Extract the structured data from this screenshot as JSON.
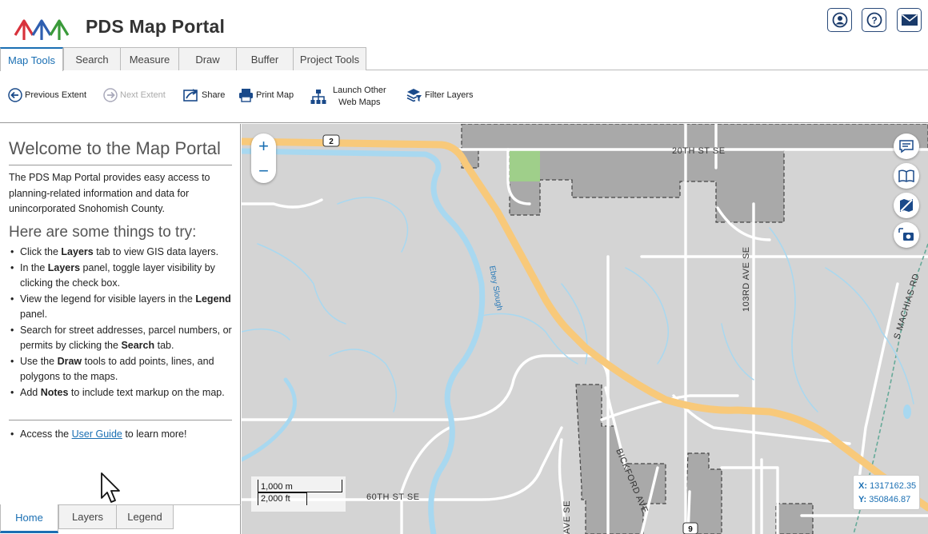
{
  "app": {
    "title": "PDS Map Portal"
  },
  "header_buttons": [
    {
      "icon": "user-icon"
    },
    {
      "icon": "help-icon"
    },
    {
      "icon": "mail-icon"
    }
  ],
  "tabs": [
    "Map Tools",
    "Search",
    "Measure",
    "Draw",
    "Buffer",
    "Project Tools"
  ],
  "active_tab": "Map Tools",
  "toolbar": {
    "previous_extent": "Previous Extent",
    "next_extent": "Next Extent",
    "share": "Share",
    "print_map": "Print Map",
    "launch_line1": "Launch Other",
    "launch_line2": "Web Maps",
    "filter_layers": "Filter Layers"
  },
  "panel": {
    "title": "Welcome to the Map Portal",
    "intro": "The PDS Map Portal provides easy access to planning-related information and data for unincorporated Snohomish County.",
    "subtitle": "Here are some things to try:",
    "tips": [
      {
        "pre": "Click the ",
        "bold": "Layers",
        "post": " tab to view GIS data layers."
      },
      {
        "pre": "In the ",
        "bold": "Layers",
        "post": " panel, toggle layer visibility by clicking the check box."
      },
      {
        "pre": "View the legend for visible layers in the ",
        "bold": "Legend",
        "post": " panel."
      },
      {
        "pre": "Search for street addresses, parcel numbers, or permits by clicking the ",
        "bold": "Search",
        "post": " tab."
      },
      {
        "pre": "Use the ",
        "bold": "Draw",
        "post": " tools to add points, lines, and polygons to the maps."
      },
      {
        "pre": "Add ",
        "bold": "Notes",
        "post": " to include text markup on the map."
      }
    ],
    "guide_pre": "Access the ",
    "guide_link": "User Guide",
    "guide_post": " to learn more!"
  },
  "bottom_tabs": [
    "Home",
    "Layers",
    "Legend"
  ],
  "active_bottom_tab": "Home",
  "map": {
    "zoom_in": "+",
    "zoom_out": "−",
    "road_labels": {
      "r20th": "20TH ST SE",
      "r103rd": "103RD AVE SE",
      "rmachias": "S MACHIAS RD",
      "rbickford": "BICKFORD AVE",
      "r60th": "60TH ST SE",
      "rave": "AVE SE",
      "ebey": "Ebey Slough",
      "shield2": "2",
      "shield9": "9"
    },
    "scale_top": "1,000 m",
    "scale_bottom": "2,000 ft",
    "x_label": "X:",
    "x_value": "1317162.35",
    "y_label": "Y:",
    "y_value": "350846.87",
    "right_buttons": [
      "notes-icon",
      "book-icon",
      "map-off-icon",
      "screenshot-icon"
    ]
  },
  "colors": {
    "accent": "#1a6fb3",
    "highway": "#f8c97a",
    "water": "#a8d8f0",
    "parcel": "#a9a9a9",
    "land": "#d4d4d4",
    "park": "#9fcf8a"
  }
}
